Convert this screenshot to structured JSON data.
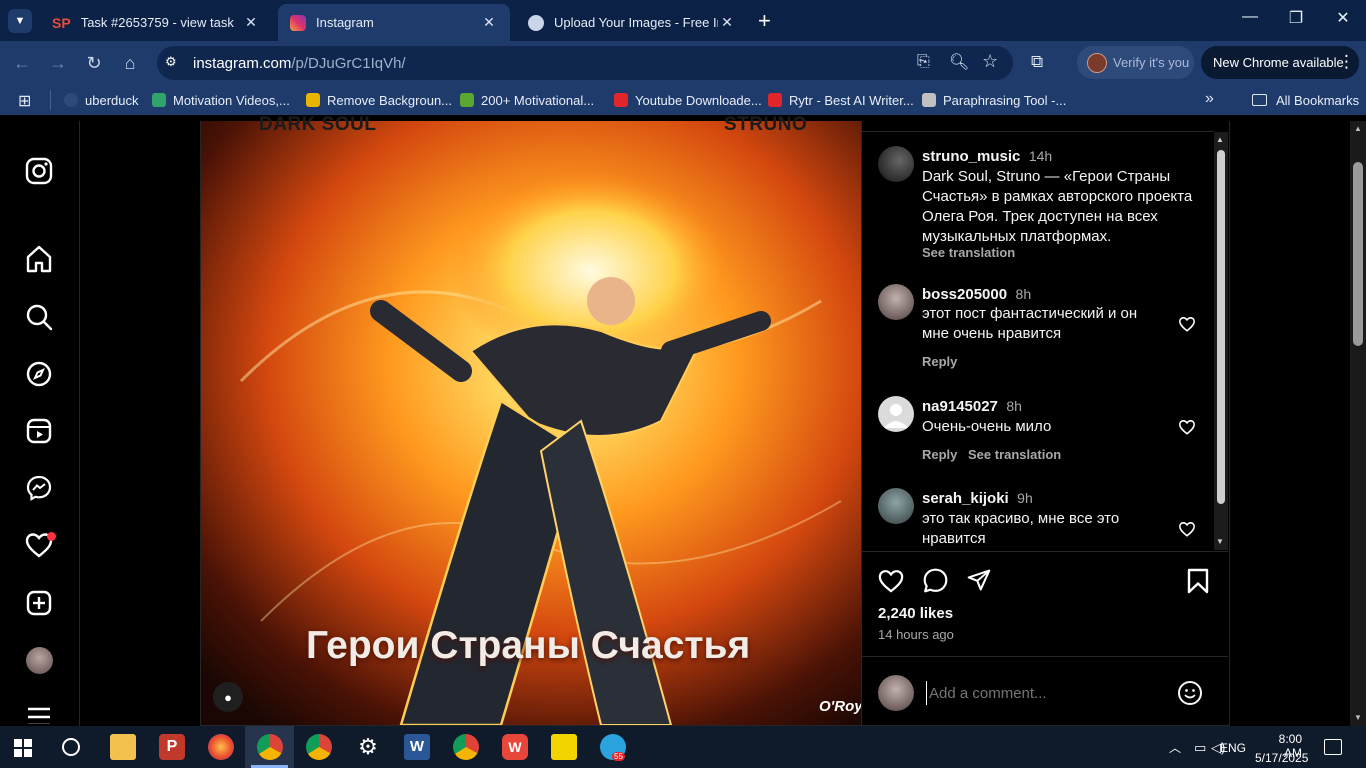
{
  "browser": {
    "tabs": [
      {
        "title": "Task #2653759 - view task",
        "icon": "sp-logo-icon"
      },
      {
        "title": "Instagram",
        "icon": "instagram-icon"
      },
      {
        "title": "Upload Your Images - Free Imag",
        "icon": "globe-icon"
      }
    ],
    "url_host": "instagram.com",
    "url_path": "/p/DJuGrC1IqVh/",
    "verify_label": "Verify it's you",
    "new_chrome_label": "New Chrome available",
    "bookmarks": [
      {
        "label": "uberduck",
        "color": "#2d4a7a"
      },
      {
        "label": "Motivation Videos,...",
        "color": "#2fa36b"
      },
      {
        "label": "Remove Backgroun...",
        "color": "#e8b400"
      },
      {
        "label": "200+ Motivational...",
        "color": "#5aa832"
      },
      {
        "label": "Youtube Downloade...",
        "color": "#e0262b"
      },
      {
        "label": "Rytr - Best AI Writer...",
        "color": "#e0262b"
      },
      {
        "label": "Paraphrasing Tool -...",
        "color": "#c0c0c0"
      }
    ],
    "all_bookmarks_label": "All Bookmarks"
  },
  "post": {
    "image_text_left": "DARK SOUL",
    "image_text_right": "STRUNO",
    "image_title": "Герои Страны Счастья",
    "image_watermark": "O'Roy",
    "caption": {
      "username": "struno_music",
      "time": "14h",
      "text": "Dark Soul, Struno — «Герои Страны Счастья» в рамках авторского проекта Олега Роя. Трек доступен на всех музыкальных платформах.",
      "see_translation": "See translation"
    },
    "comments": [
      {
        "username": "boss205000",
        "time": "8h",
        "text": "этот пост фантастический и он мне очень нравится",
        "reply": "Reply",
        "see_translation": ""
      },
      {
        "username": "na9145027",
        "time": "8h",
        "text": "Очень-очень мило",
        "reply": "Reply",
        "see_translation": "See translation"
      },
      {
        "username": "serah_kijoki",
        "time": "9h",
        "text": "это так красиво, мне все это нравится",
        "reply": "",
        "see_translation": ""
      }
    ],
    "likes": "2,240 likes",
    "posted": "14 hours ago",
    "comment_placeholder": "Add a comment..."
  },
  "taskbar": {
    "lang": "ENG",
    "time": "8:00 AM",
    "date": "5/17/2025",
    "telegram_badge": "55"
  },
  "colors": {
    "chrome_dark": "#0b2146",
    "chrome_toolbar": "#1e3b6c",
    "ig_bg": "#000000",
    "notification_dot": "#ff3040"
  }
}
